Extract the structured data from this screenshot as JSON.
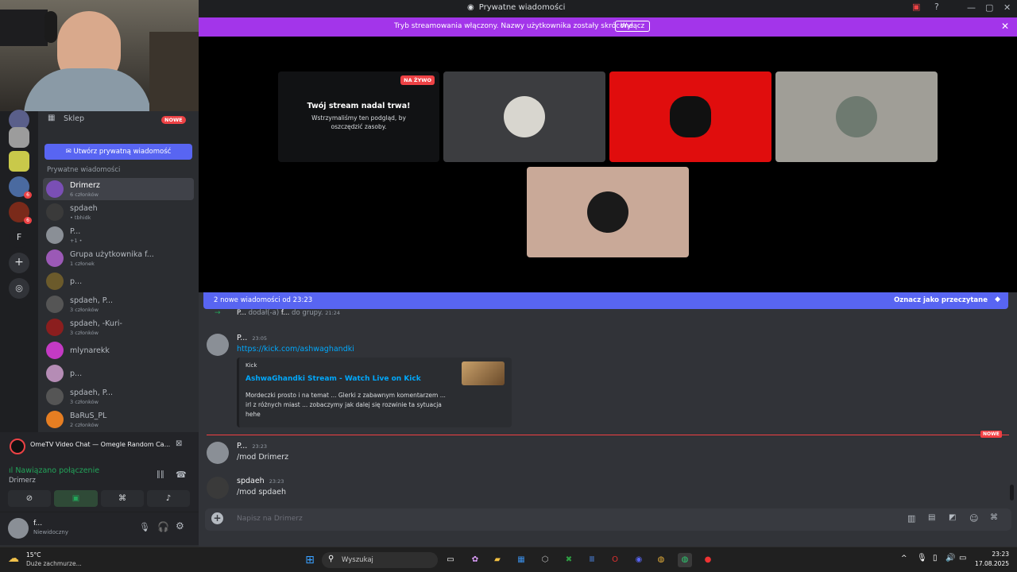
{
  "window": {
    "title": "Prywatne wiadomości"
  },
  "banner": {
    "text": "Tryb streamowania włączony. Nazwy użytkownika zostały skrócone.",
    "button": "Wyłącz"
  },
  "stream": {
    "live_badge": "NA ŻYWO",
    "title": "Twój stream nadal trwa!",
    "subtitle": "Wstrzymaliśmy ten podgląd, by oszczędzić zasoby."
  },
  "sidebar": {
    "shop_label": "Sklep",
    "shop_badge": "NOWE",
    "new_dm_button": "Utwórz prywatną wiadomość",
    "section_header": "Prywatne wiadomości",
    "server_letter": "F",
    "server_badges": [
      "6",
      "6"
    ],
    "dms": [
      {
        "name": "Drimerz",
        "sub": "6 członków",
        "color": "#7a4fb5"
      },
      {
        "name": "spdaeh",
        "sub": "• tbhidk",
        "color": "#3a3a3a"
      },
      {
        "name": "P...",
        "sub": "+1 •",
        "color": "#8a8f96"
      },
      {
        "name": "Grupa użytkownika f...",
        "sub": "1 członek",
        "color": "#9b59b6"
      },
      {
        "name": "p...",
        "sub": "",
        "color": "#6b5a2b"
      },
      {
        "name": "spdaeh, P...",
        "sub": "3 członków",
        "color": "#555"
      },
      {
        "name": "spdaeh, -Kuri-",
        "sub": "3 członków",
        "color": "#8b1e1e"
      },
      {
        "name": "mlynarekk",
        "sub": "",
        "color": "#c43ac4"
      },
      {
        "name": "p...",
        "sub": "",
        "color": "#b58cb5"
      },
      {
        "name": "spdaeh, P...",
        "sub": "3 członków",
        "color": "#555"
      },
      {
        "name": "BaRuS_PL",
        "sub": "2 członków",
        "color": "#e67e22"
      }
    ]
  },
  "voice": {
    "activity": "OmeTV Video Chat — Omegle Random Ca...",
    "status": "Nawiązano połączenie",
    "channel": "Drimerz"
  },
  "user": {
    "name": "f...",
    "status": "Niewidoczny"
  },
  "chat": {
    "new_messages": "2 nowe wiadomości od 23:23",
    "mark_read": "Oznacz jako przeczytane",
    "system": {
      "actor": "P...",
      "text": "dodał(-a)",
      "target": "f...",
      "text2": "do grupy.",
      "time": "21:24"
    },
    "messages": [
      {
        "author": "P...",
        "time": "23:05",
        "text": "https://kick.com/ashwaghandki"
      },
      {
        "author": "P...",
        "time": "23:23",
        "text": "/mod Drimerz"
      },
      {
        "author": "spdaeh",
        "time": "23:23",
        "text": "/mod spdaeh"
      }
    ],
    "embed": {
      "provider": "Kick",
      "title": "AshwaGhandki Stream - Watch Live on Kick",
      "description_lines": [
        "Mordeczki prosto i na temat ... Glerki z zabawnym komentarzem ...",
        "irl z różnych miast ... zobaczymy jak dalej się rozwinie ta sytuacja",
        "hehe"
      ]
    },
    "new_divider": "NOWE",
    "input_placeholder": "Napisz na Drimerz"
  },
  "taskbar": {
    "weather_temp": "15°C",
    "weather_desc": "Duże zachmurze...",
    "search_placeholder": "Wyszukaj",
    "time": "23:23",
    "date": "17.08.2025"
  },
  "colors": {
    "accent": "#5865f2",
    "stream_banner": "#a335ea",
    "live": "#ed4245",
    "online": "#23a55a"
  }
}
